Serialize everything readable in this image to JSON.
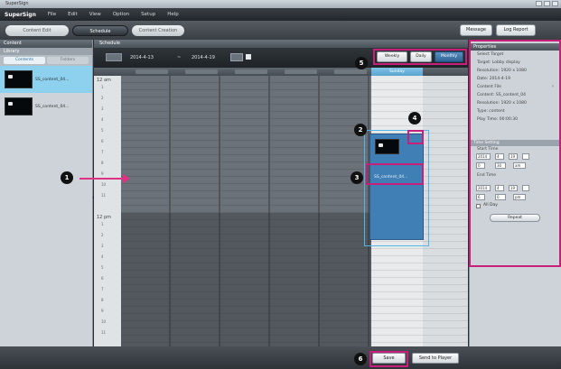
{
  "window": {
    "title": "SuperSign"
  },
  "menu": {
    "brand": "SuperSign",
    "items": [
      "File",
      "Edit",
      "View",
      "Option",
      "Setup",
      "Help"
    ]
  },
  "toolbar": {
    "tabs": [
      "Content Edit",
      "Schedule",
      "Content Creation"
    ],
    "buttons": [
      "Message",
      "Log Report"
    ]
  },
  "left_panel": {
    "title": "Content",
    "subtitle": "Library",
    "tabs": [
      "Contents",
      "Folders"
    ],
    "items": [
      {
        "name": "SS_content_04..."
      },
      {
        "name": "SS_content_04..."
      }
    ]
  },
  "schedule": {
    "title": "Schedule",
    "date_start": "2014-4-13",
    "date_sep": "~",
    "date_end": "2014-4-19",
    "view_buttons": [
      "Weekly",
      "Daily",
      "Monthly"
    ],
    "today_header": "Sunday",
    "am_label": "12 am",
    "pm_label": "12 pm",
    "hours": [
      "1",
      "2",
      "3",
      "4",
      "5",
      "6",
      "7",
      "8",
      "9",
      "10",
      "11"
    ],
    "event_name": "SS_content_04..."
  },
  "properties": {
    "title": "Properties",
    "rows": [
      {
        "label": "Select Target"
      },
      {
        "label": "Target: Lobby display"
      },
      {
        "label": "Resolution: 1920 x 1080"
      },
      {
        "label": "Date: 2014-4-19"
      },
      {
        "label": "Content File"
      },
      {
        "label": "Content: SS_content_04"
      },
      {
        "label": "Resolution: 1920 x 1080"
      },
      {
        "label": "Type: content"
      },
      {
        "label": "Play Time: 00:00:30"
      }
    ],
    "time_section": "Time Setting",
    "start_label": "Start Time",
    "end_label": "End Time",
    "start_date": "2014",
    "start_month": "4",
    "start_day": "19",
    "start_hour": "0",
    "start_min": "30",
    "start_ampm": "am",
    "end_date": "2014",
    "end_month": "4",
    "end_day": "19",
    "end_hour": "6",
    "end_min": "0",
    "end_ampm": "pm",
    "allday_label": "All Day",
    "apply_label": "Repeat"
  },
  "bottom": {
    "save_label": "Save",
    "send_label": "Send to Player"
  },
  "callouts": [
    "1",
    "2",
    "3",
    "4",
    "5",
    "6"
  ]
}
